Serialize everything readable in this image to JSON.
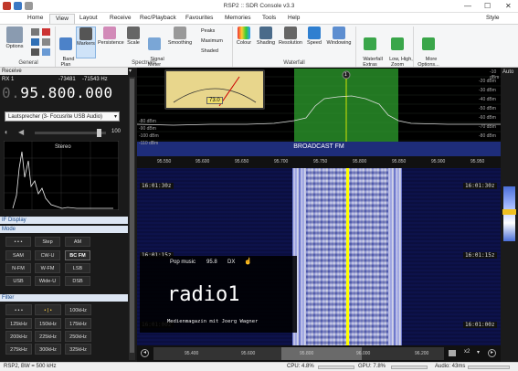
{
  "window": {
    "title": "RSP2 :: SDR Console v3.3",
    "controls": {
      "minimize": "—",
      "maximize": "☐",
      "close": "✕"
    }
  },
  "menu": {
    "tabs": [
      "Home",
      "View",
      "Layout",
      "Receive",
      "Rec/Playback",
      "Favourites",
      "Memories",
      "Tools",
      "Help"
    ],
    "active": "View",
    "style_label": "Style"
  },
  "ribbon": {
    "groups": {
      "general": "General",
      "spectrum": "Spectrum",
      "waterfall": "Waterfall"
    },
    "options": "Options",
    "band_plan": "Band\nPlan",
    "markers": "Markers",
    "persistence": "Persistence",
    "scale": "Scale",
    "signal_meter": "Signal\nMeter",
    "smoothing": "Smoothing",
    "peaks": "Peaks",
    "maximum": "Maximum",
    "shaded": "Shaded",
    "colour": "Colour",
    "shading": "Shading",
    "resolution": "Resolution",
    "speed": "Speed",
    "windowing": "Windowing",
    "waterfall_extras": "Waterfall\nExtras",
    "low_high_zoom": "Low, High,\nZoom",
    "more_options": "More\nOptions...",
    "auto": "Auto"
  },
  "receive": {
    "header": "Receive",
    "rx_label": "RX 1",
    "level": "-73481",
    "freq_offset": "-71543 Hz",
    "frequency_dim": "0.",
    "frequency": "95.800.000",
    "audio_device": "Lautsprecher (3- Focusrite USB Audio)",
    "volume_value": "100",
    "stereo_label": "Stereo"
  },
  "if_display_label": "IF Display",
  "mode": {
    "header": "Mode",
    "buttons": [
      "• • •",
      "Step",
      "AM",
      "SAM",
      "CW-U",
      "BC FM",
      "N-FM",
      "W-FM",
      "LSB",
      "USB",
      "Wide-U",
      "DSB"
    ],
    "selected": "BC FM"
  },
  "filter": {
    "header": "Filter",
    "buttons": [
      "• • •",
      "• | •",
      "100kHz",
      "125kHz",
      "150kHz",
      "175kHz",
      "200kHz",
      "225kHz",
      "250kHz",
      "275kHz",
      "300kHz",
      "325kHz"
    ]
  },
  "spectrum": {
    "meter_value": "73.0",
    "db_scale": [
      "-10 dBm",
      "-20 dBm",
      "-30 dBm",
      "-40 dBm",
      "-50 dBm",
      "-60 dBm",
      "-70 dBm",
      "-80 dBm",
      "-90 dBm",
      "-100 dBm",
      "-110 dBm"
    ],
    "freq_ticks": [
      "95.550",
      "95.600",
      "95.650",
      "95.700",
      "95.750",
      "95.800",
      "95.850",
      "95.900",
      "95.950",
      "96.000"
    ],
    "band_label": "BROADCAST FM",
    "marker": "1"
  },
  "waterfall": {
    "times": [
      "16:01:30z",
      "16:01:15z",
      "16:01:00z"
    ],
    "rds": {
      "pty": "Pop music",
      "freq": "95.8",
      "dx": "DX",
      "station": "radio1",
      "radiotext": "Medienmagazin mit Joerg Wagner"
    },
    "scroll_ticks": [
      "95.400",
      "95.600",
      "95.800",
      "96.000",
      "96.200"
    ],
    "zoom": "x2"
  },
  "status": {
    "device": "RSP2, BW = 500 kHz",
    "cpu": "CPU: 4.8%",
    "gpu": "GPU: 7.8%",
    "audio": "Audio: 43ms"
  },
  "colors": {
    "accent": "#0078d7",
    "waterfall_bg": "#0a0d3a",
    "signal": "#e8e8ff",
    "marker_line": "#ffff00",
    "passband": "#2ea02e"
  }
}
